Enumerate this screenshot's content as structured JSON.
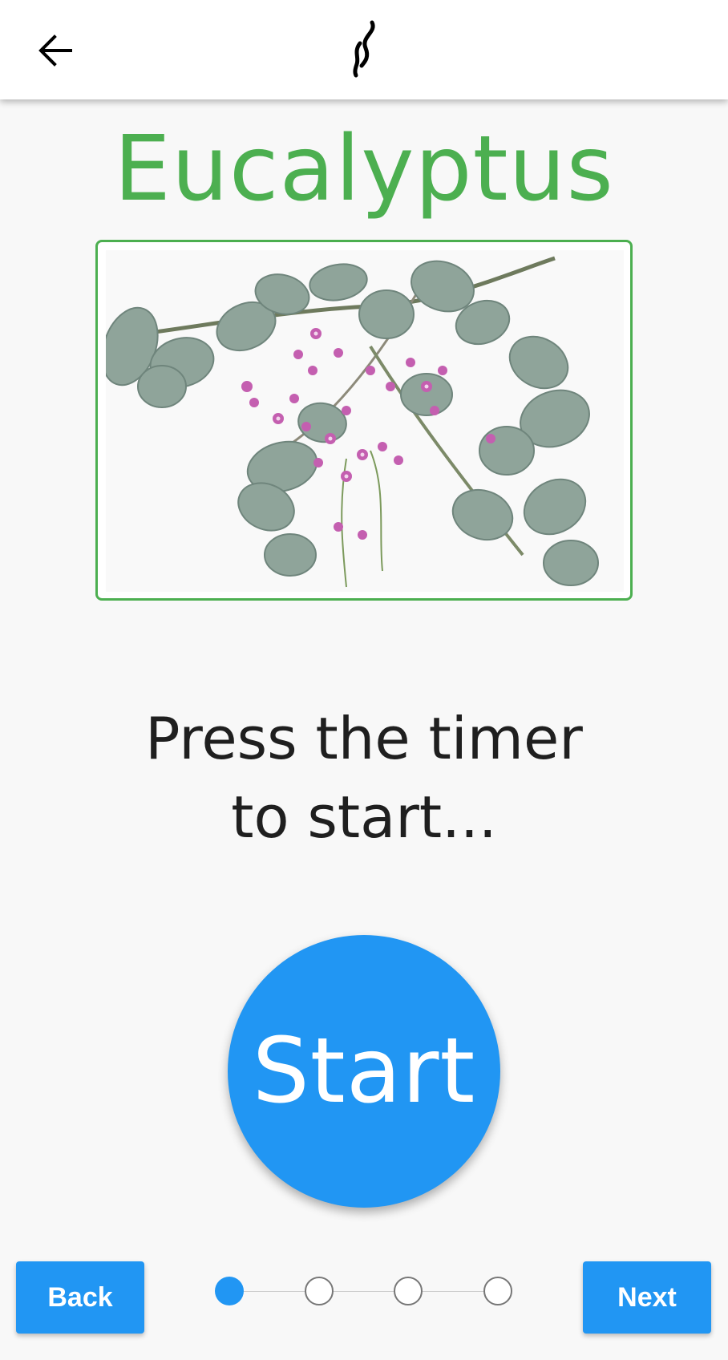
{
  "app_bar": {
    "back_icon": "arrow-left-icon",
    "logo_icon": "wavy-steam-logo-icon"
  },
  "page": {
    "title": "Eucalyptus",
    "image_alt": "eucalyptus-branch-with-pink-flowers",
    "instruction": "Press the timer to start..."
  },
  "timer": {
    "start_label": "Start"
  },
  "footer": {
    "back_label": "Back",
    "next_label": "Next"
  },
  "stepper": {
    "total_steps": 4,
    "current_step": 1
  },
  "colors": {
    "accent_blue": "#2196f3",
    "title_green": "#4caf50",
    "background": "#f8f8f8"
  }
}
